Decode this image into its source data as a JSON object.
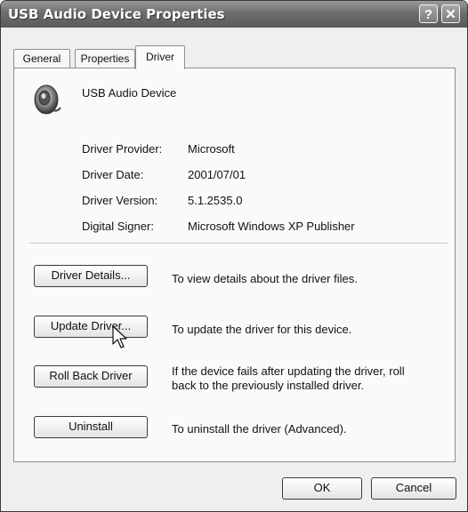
{
  "window": {
    "title": "USB Audio Device Properties"
  },
  "titlebar_buttons": {
    "help": "?",
    "close": "✕"
  },
  "tabs": [
    {
      "label": "General",
      "active": false
    },
    {
      "label": "Properties",
      "active": false
    },
    {
      "label": "Driver",
      "active": true
    }
  ],
  "device": {
    "name": "USB Audio Device",
    "icon": "speaker-icon"
  },
  "info": [
    {
      "label": "Driver Provider:",
      "value": "Microsoft"
    },
    {
      "label": "Driver Date:",
      "value": "2001/07/01"
    },
    {
      "label": "Driver Version:",
      "value": "5.1.2535.0"
    },
    {
      "label": "Digital Signer:",
      "value": "Microsoft Windows XP Publisher"
    }
  ],
  "actions": [
    {
      "button": "Driver Details...",
      "description": "To view details about the driver files."
    },
    {
      "button": "Update Driver...",
      "description": "To update the driver for this device."
    },
    {
      "button": "Roll Back Driver",
      "description": "If the device fails after updating the driver, roll back to the previously installed driver."
    },
    {
      "button": "Uninstall",
      "description": "To uninstall the driver (Advanced)."
    }
  ],
  "footer": {
    "ok": "OK",
    "cancel": "Cancel"
  }
}
